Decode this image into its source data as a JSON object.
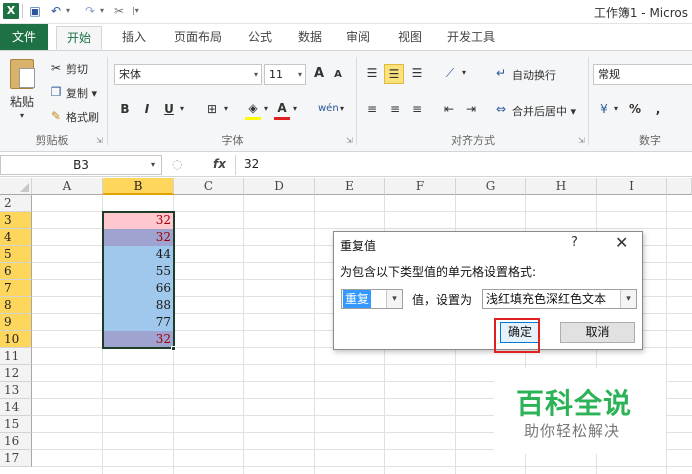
{
  "window": {
    "title": "工作簿1 - Micros"
  },
  "quick_access": {
    "icons": [
      "excel-icon",
      "save-icon",
      "undo-icon",
      "redo-icon",
      "format-painter-icon"
    ]
  },
  "ribbon_tabs": [
    "文件",
    "开始",
    "插入",
    "页面布局",
    "公式",
    "数据",
    "审阅",
    "视图",
    "开发工具"
  ],
  "ribbon": {
    "clipboard": {
      "paste": "粘贴",
      "cut": "剪切",
      "copy": "复制 ▾",
      "format_painter": "格式刷",
      "group_label": "剪贴板"
    },
    "font": {
      "font_name": "宋体",
      "font_size": "11",
      "grow": "A",
      "shrink": "A",
      "bold": "B",
      "italic": "I",
      "underline": "U",
      "phonetic": "wén",
      "group_label": "字体"
    },
    "alignment": {
      "wrap_text": "自动换行",
      "merge_center": "合并后居中 ▾",
      "group_label": "对齐方式"
    },
    "number": {
      "format": "常规",
      "percent": "%",
      "comma": ",",
      "group_label": "数字"
    }
  },
  "formula_bar": {
    "name_box": "B3",
    "fx": "fx",
    "content": "32"
  },
  "grid": {
    "columns": [
      "A",
      "B",
      "C",
      "D",
      "E",
      "F",
      "G",
      "H",
      "I"
    ],
    "rows": [
      "2",
      "3",
      "4",
      "5",
      "6",
      "7",
      "8",
      "9",
      "10",
      "11",
      "12",
      "13",
      "14",
      "15",
      "16",
      "17"
    ],
    "column_b_values": [
      {
        "row": "3",
        "value": "32",
        "highlight": "duplicate"
      },
      {
        "row": "4",
        "value": "32",
        "highlight": "duplicate"
      },
      {
        "row": "5",
        "value": "44",
        "highlight": "unique"
      },
      {
        "row": "6",
        "value": "55",
        "highlight": "unique"
      },
      {
        "row": "7",
        "value": "66",
        "highlight": "unique"
      },
      {
        "row": "8",
        "value": "88",
        "highlight": "unique"
      },
      {
        "row": "9",
        "value": "77",
        "highlight": "unique"
      },
      {
        "row": "10",
        "value": "32",
        "highlight": "duplicate"
      }
    ],
    "selected_column": "B",
    "selected_rows": [
      "3",
      "4",
      "5",
      "6",
      "7",
      "8",
      "9",
      "10"
    ]
  },
  "dialog": {
    "title": "重复值",
    "help": "?",
    "close": "✕",
    "prompt": "为包含以下类型值的单元格设置格式:",
    "type_value": "重复",
    "middle_label": "值，设置为",
    "format_value": "浅红填充色深红色文本",
    "ok": "确定",
    "cancel": "取消"
  },
  "watermark": {
    "main": "百科全说",
    "sub": "助你轻松解决"
  },
  "colors": {
    "excel_green": "#1e7145",
    "duplicate_fill": "#ffc7ce",
    "duplicate_text": "#9c0006",
    "highlight_red": "#e02020",
    "watermark_green": "#2db357"
  }
}
